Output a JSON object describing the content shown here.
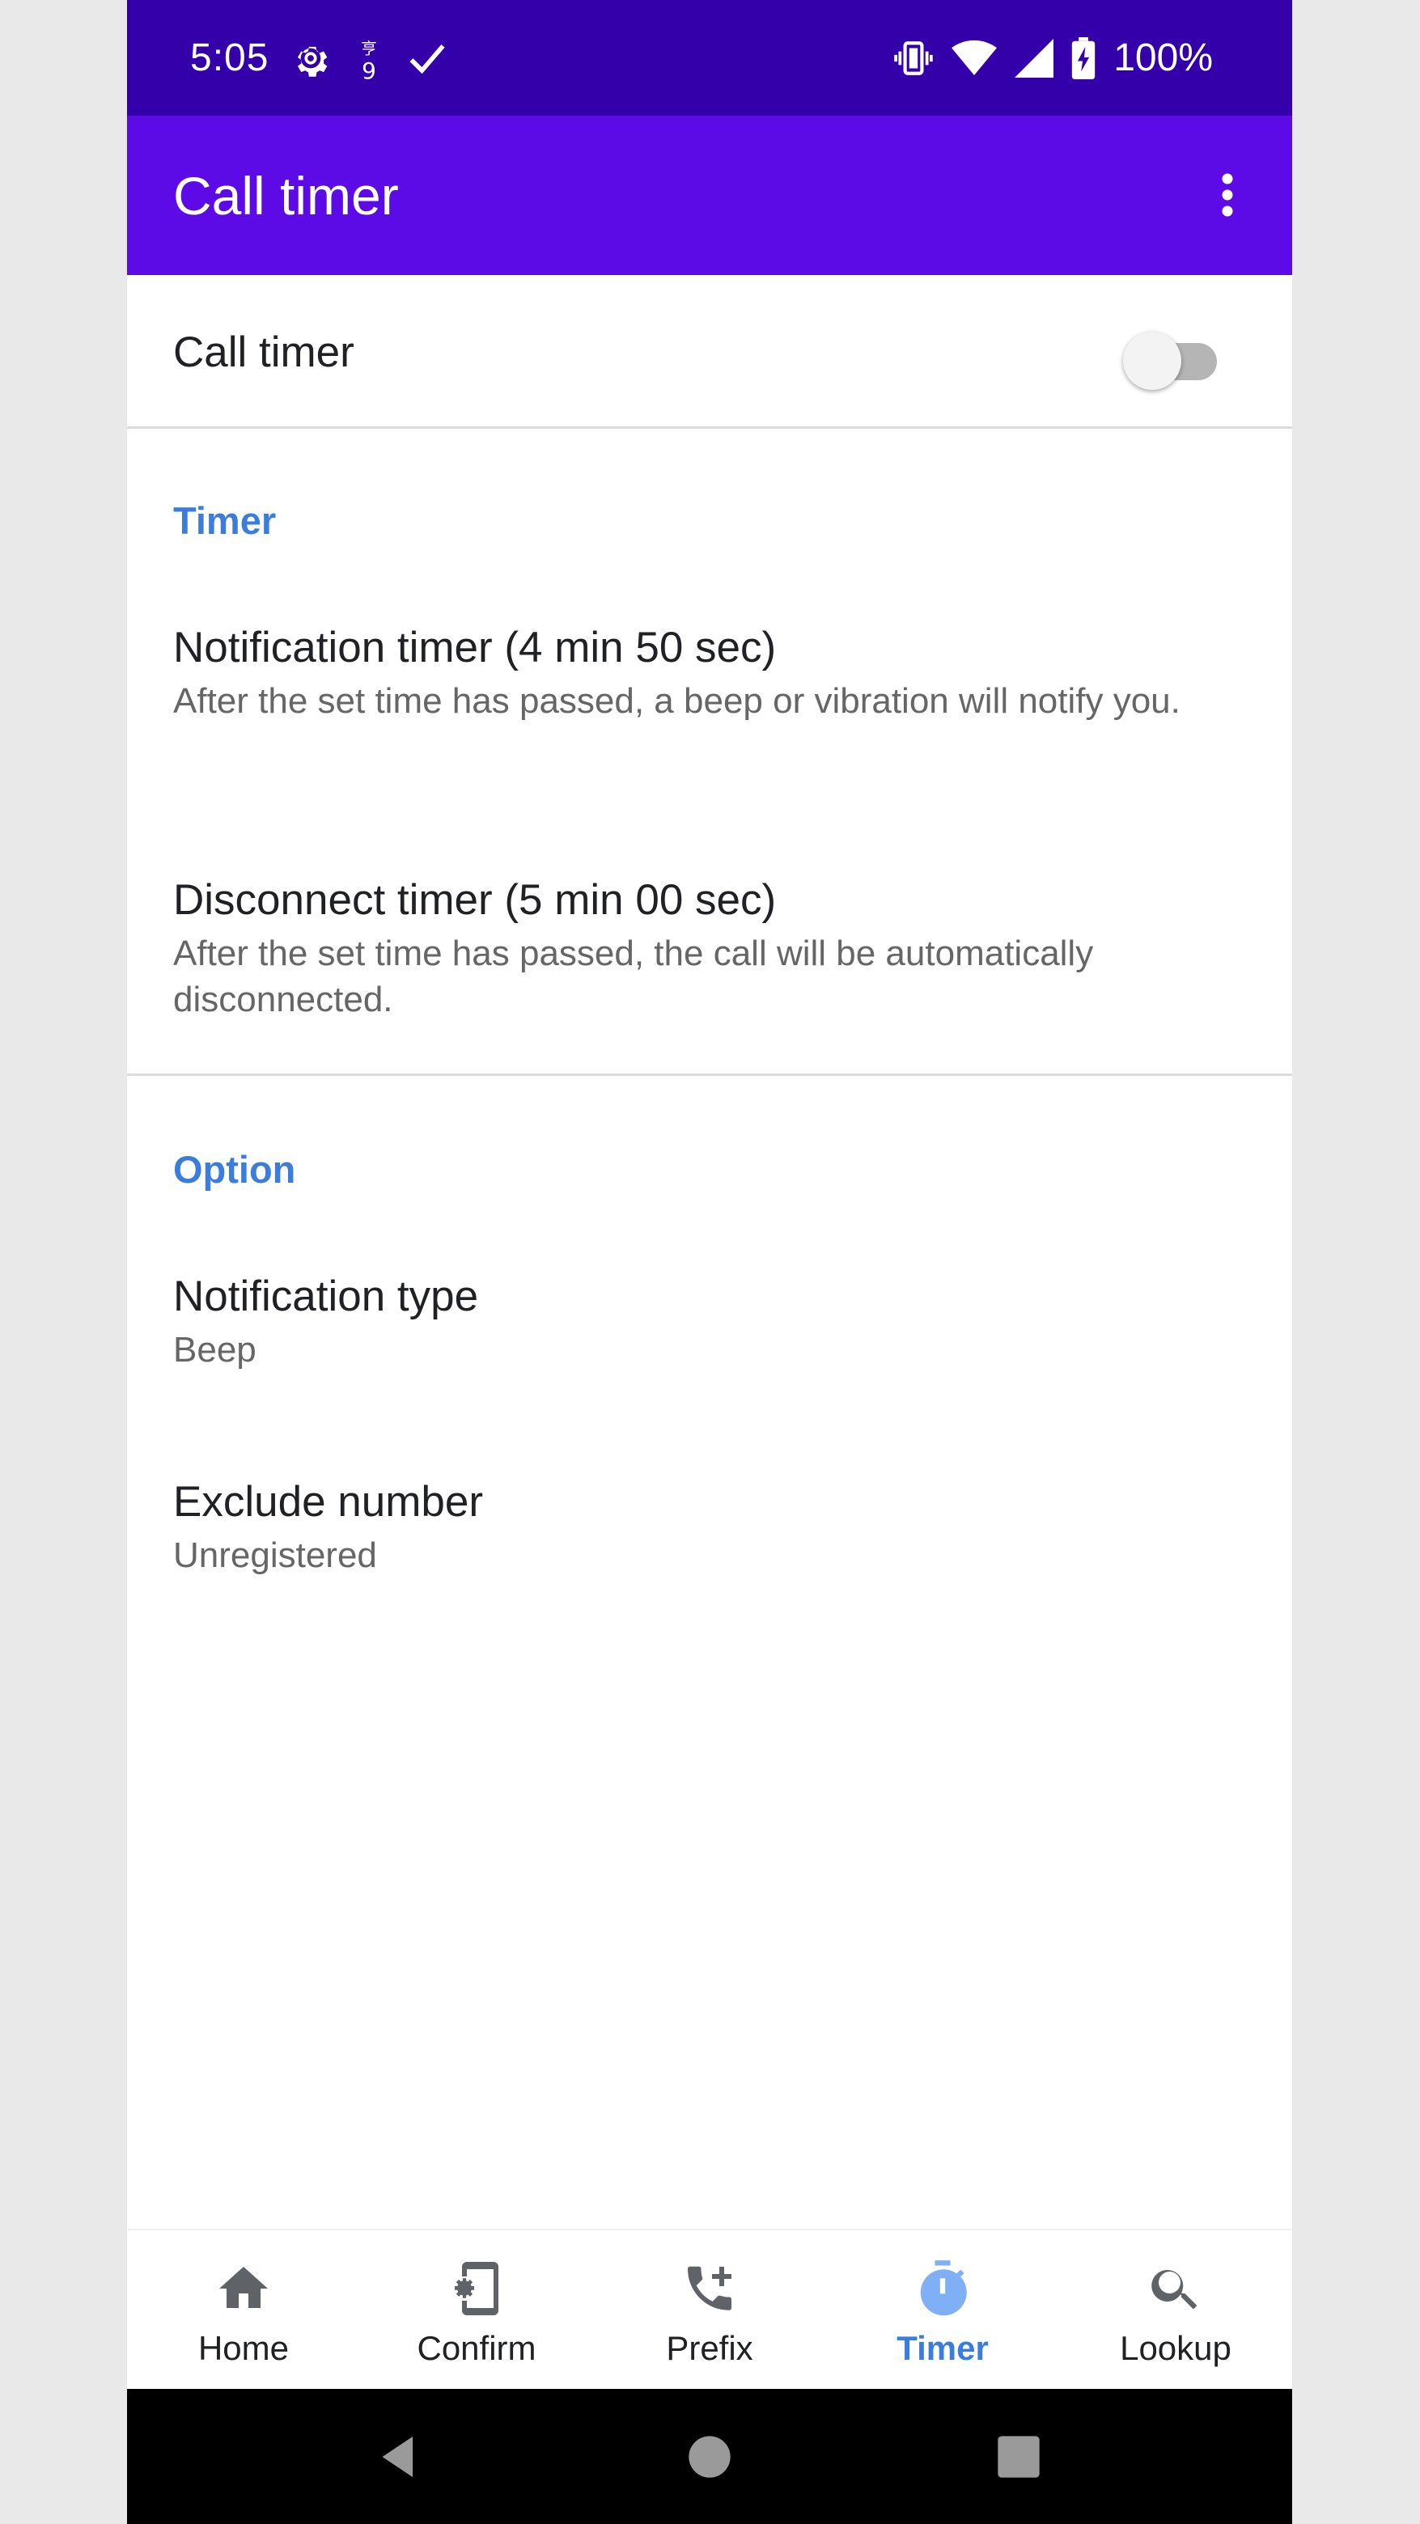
{
  "status_bar": {
    "time": "5:05",
    "battery": "100%"
  },
  "app_bar": {
    "title": "Call timer"
  },
  "master_switch": {
    "label": "Call timer",
    "enabled": false
  },
  "sections": {
    "timer": {
      "header": "Timer",
      "items": [
        {
          "title": "Notification timer (4 min 50 sec)",
          "summary": "After the set time has passed, a beep or vibration will notify you."
        },
        {
          "title": "Disconnect timer (5 min 00 sec)",
          "summary": "After the set time has passed, the call will be automatically disconnected."
        }
      ]
    },
    "option": {
      "header": "Option",
      "items": [
        {
          "title": "Notification type",
          "summary": "Beep"
        },
        {
          "title": "Exclude number",
          "summary": "Unregistered"
        }
      ]
    }
  },
  "bottom_nav": {
    "active": "Timer",
    "items": [
      {
        "label": "Home",
        "icon": "home-icon"
      },
      {
        "label": "Confirm",
        "icon": "phone-settings-icon"
      },
      {
        "label": "Prefix",
        "icon": "phone-add-icon"
      },
      {
        "label": "Timer",
        "icon": "stopwatch-icon"
      },
      {
        "label": "Lookup",
        "icon": "search-icon"
      }
    ]
  },
  "colors": {
    "status_bar": "#3300aa",
    "app_bar": "#5c0ae6",
    "accent": "#3b7ddd",
    "nav_active_icon": "#7fb0f5"
  }
}
